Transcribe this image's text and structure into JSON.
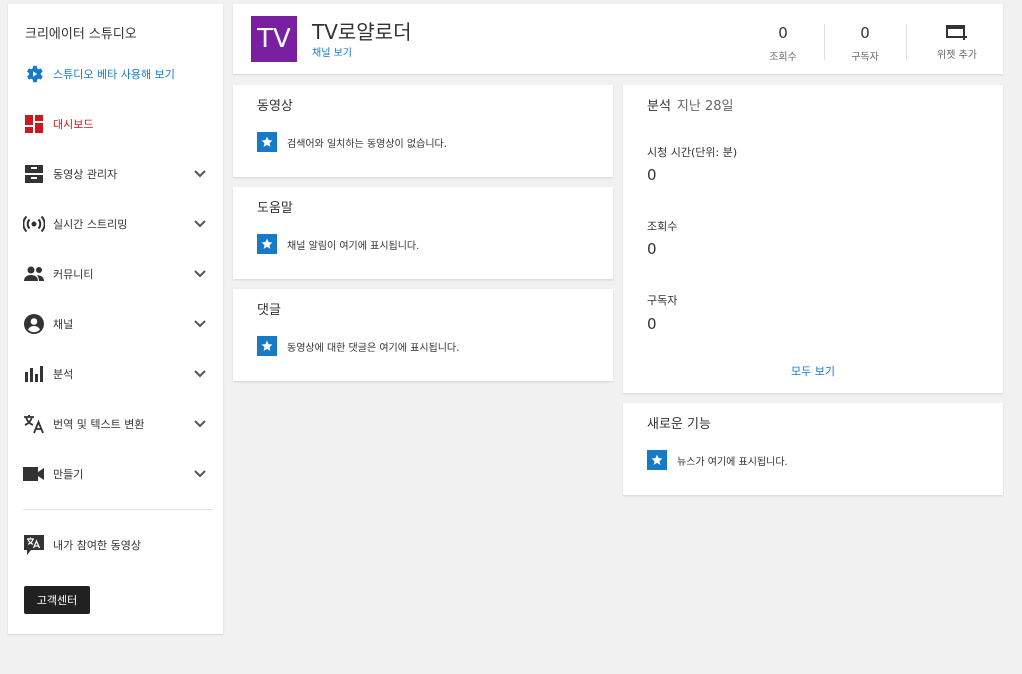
{
  "sidebar": {
    "title": "크리에이터 스튜디오",
    "items": [
      {
        "label": "스튜디오 베타 사용해 보기",
        "icon": "gear-play-icon",
        "color": "#167ac6"
      },
      {
        "label": "대시보드",
        "icon": "dashboard-icon",
        "color": "#cc181e"
      },
      {
        "label": "동영상 관리자",
        "icon": "video-manager-icon"
      },
      {
        "label": "실시간 스트리밍",
        "icon": "live-stream-icon"
      },
      {
        "label": "커뮤니티",
        "icon": "community-icon"
      },
      {
        "label": "채널",
        "icon": "channel-icon"
      },
      {
        "label": "분석",
        "icon": "analytics-icon"
      },
      {
        "label": "번역 및 텍스트 변환",
        "icon": "translate-icon"
      },
      {
        "label": "만들기",
        "icon": "camera-icon"
      }
    ],
    "contributed": {
      "label": "내가 참여한 동영상",
      "icon": "translate-bubble-icon"
    },
    "help_button": "고객센터"
  },
  "header": {
    "avatar_text": "TV",
    "avatar_color": "#7b1fa2",
    "channel_name": "TV로얄로더",
    "view_channel": "채널 보기",
    "stats": [
      {
        "value": "0",
        "label": "조회수"
      },
      {
        "value": "0",
        "label": "구독자"
      }
    ],
    "add_widget": "위젯 추가"
  },
  "videos_card": {
    "title": "동영상",
    "message": "검색어와 일치하는 동영상이 없습니다."
  },
  "help_card": {
    "title": "도움말",
    "message": "채널 알림이 여기에 표시됩니다."
  },
  "comments_card": {
    "title": "댓글",
    "message": "동영상에 대한 댓글은 여기에 표시됩니다."
  },
  "analytics_card": {
    "title": "분석",
    "period": "지난 28일",
    "metrics": [
      {
        "label": "시청 시간(단위: 분)",
        "value": "0"
      },
      {
        "label": "조회수",
        "value": "0"
      },
      {
        "label": "구독자",
        "value": "0"
      }
    ],
    "see_all": "모두 보기"
  },
  "news_card": {
    "title": "새로운 기능",
    "message": "뉴스가 여기에 표시됩니다."
  },
  "colors": {
    "accent": "#167ac6",
    "active": "#cc181e",
    "background": "#f1f1f1"
  }
}
